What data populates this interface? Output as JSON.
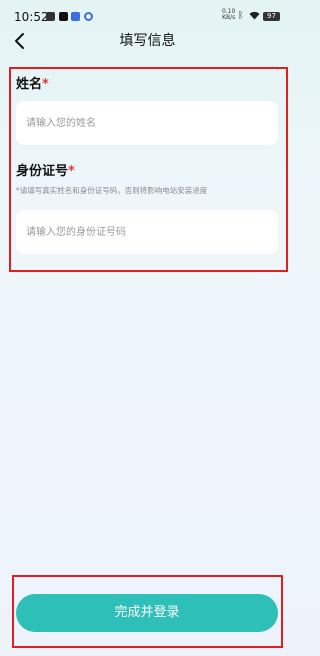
{
  "status_bar": {
    "time": "10:52",
    "net_speed_value": "0.10",
    "net_speed_unit": "KB/s",
    "battery": "97"
  },
  "header": {
    "title": "填写信息"
  },
  "form": {
    "name": {
      "label": "姓名",
      "required_mark": "*",
      "placeholder": "请输入您的姓名",
      "value": ""
    },
    "id_card": {
      "label": "身份证号",
      "required_mark": "*",
      "hint": "*请填写真实姓名和身份证号码，否则将影响电站安装进度",
      "placeholder": "请输入您的身份证号码",
      "value": ""
    }
  },
  "actions": {
    "submit_label": "完成并登录"
  },
  "colors": {
    "accent": "#2ebfb8",
    "required": "#e53935",
    "highlight_border": "#e02020"
  }
}
